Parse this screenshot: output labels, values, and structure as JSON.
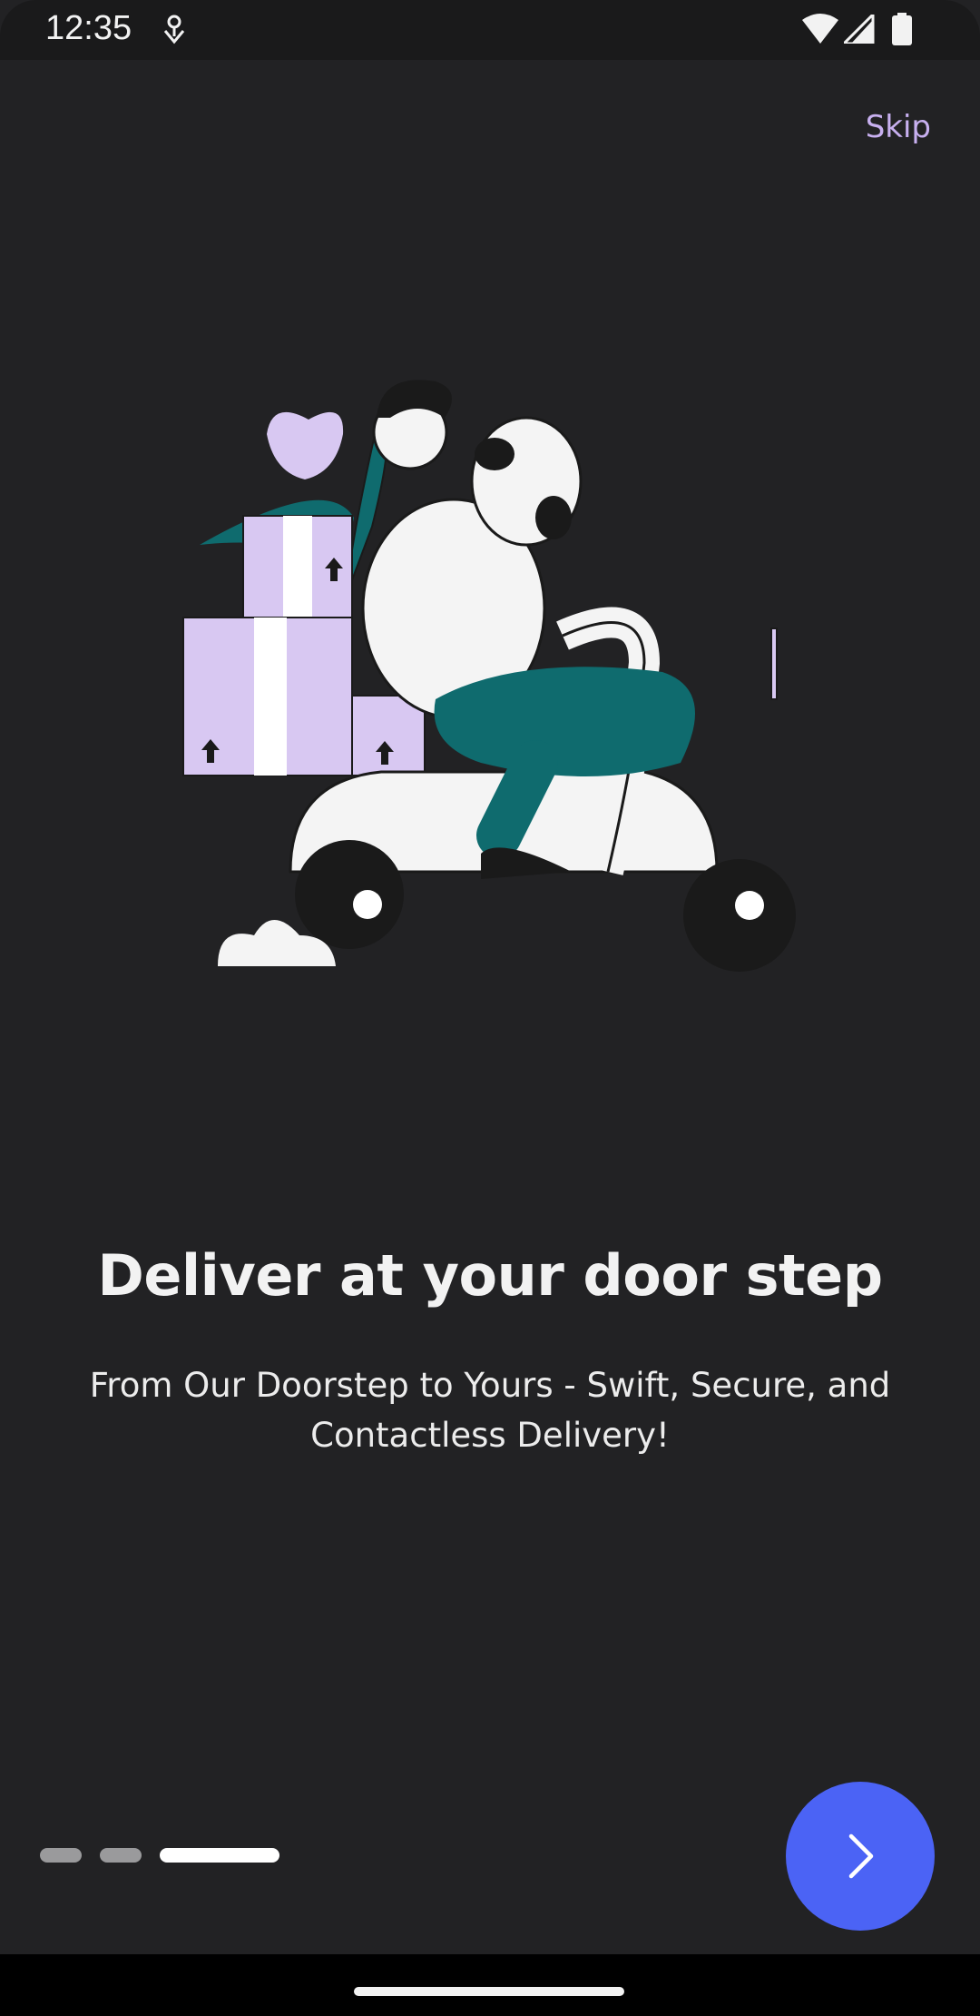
{
  "status_bar": {
    "time": "12:35",
    "icons": [
      "notification-icon",
      "wifi-icon",
      "signal-icon",
      "battery-icon"
    ]
  },
  "header": {
    "skip_label": "Skip"
  },
  "onboarding": {
    "illustration": "delivery-scooter-illustration",
    "title": "Deliver at your door step",
    "subtitle_line1": "From Our Doorstep to Yours - Swift, Secure, and",
    "subtitle_line2": "Contactless Delivery!",
    "page_count": 3,
    "current_page": 3
  },
  "footer": {
    "next_icon": "chevron-right-icon"
  },
  "colors": {
    "background": "#222224",
    "accent": "#4b63f5",
    "skip": "#c8b0f0",
    "lavender": "#d8c8f2",
    "teal": "#0f6b6e"
  }
}
